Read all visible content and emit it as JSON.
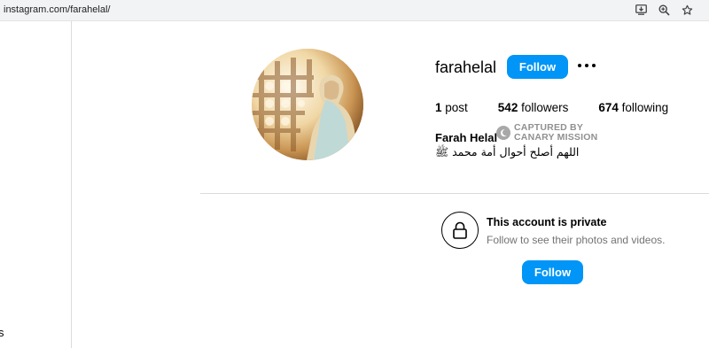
{
  "browser": {
    "url": "instagram.com/farahelal/",
    "icons": [
      "install-app-icon",
      "zoom-icon",
      "bookmark-star-icon"
    ]
  },
  "sidebar": {
    "partial_label": "s"
  },
  "profile": {
    "username": "farahelal",
    "follow_label": "Follow",
    "more_icon": "more-options-icon",
    "stats": {
      "posts_count": "1",
      "posts_label": " post",
      "followers_count": "542",
      "followers_label": " followers",
      "following_count": "674",
      "following_label": " following"
    },
    "full_name": "Farah Helal",
    "watermark_line1": "CAPTURED BY",
    "watermark_line2": "CANARY MISSION",
    "bio": "اللهم أصلح أحوال أمة محمد ﷺ"
  },
  "private_notice": {
    "icon": "lock-icon",
    "title": "This account is private",
    "subtitle": "Follow to see their photos and videos.",
    "follow_label": "Follow"
  },
  "colors": {
    "accent": "#0095f6",
    "border": "#dbdbdb",
    "muted_text": "#737373"
  }
}
